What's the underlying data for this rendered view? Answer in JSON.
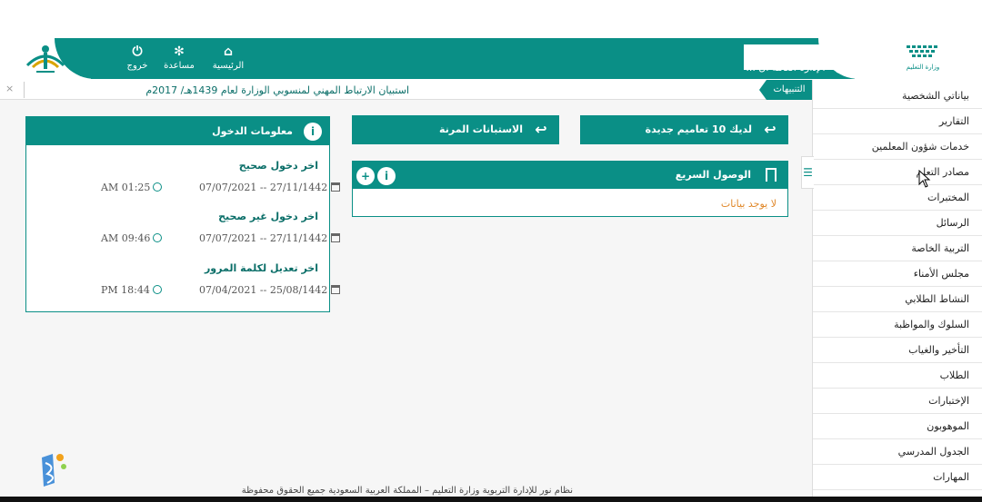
{
  "header": {
    "nav": [
      {
        "label": "الرئيسية",
        "icon": "home-icon"
      },
      {
        "label": "مساعدة",
        "icon": "gear-icon"
      },
      {
        "label": "خروج",
        "icon": "power-icon"
      }
    ],
    "user_text": "ين - الإدارة العامة ال ...",
    "logo_right_text": "وزارة التعليم"
  },
  "alerts": {
    "tab_label": "التنبيهات",
    "text": "استبيان الارتباط المهني لمنسوبي الوزارة لعام 1439هـ/ 2017م",
    "close": "×"
  },
  "sidebar": {
    "toggle": "☰",
    "items": [
      "بياناتي الشخصية",
      "التقارير",
      "خدمات شؤون المعلمين",
      "مصادر التعلم",
      "المختبرات",
      "الرسائل",
      "التربية الخاصة",
      "مجلس الأمناء",
      "النشاط الطلابي",
      "السلوك والمواظبة",
      "التأخير والغياب",
      "الطلاب",
      "الإختبارات",
      "الموهوبون",
      "الجدول المدرسي",
      "المهارات"
    ]
  },
  "buttons": {
    "circulars": "لديك 10 تعاميم جديدة",
    "surveys": "الاستبانات المرنة"
  },
  "quick_access": {
    "title": "الوصول السريع",
    "empty": "لا يوجد بيانات"
  },
  "login_info": {
    "title": "معلومات الدخول",
    "rows": [
      {
        "label": "اخر دخول صحيح",
        "date": "07/07/2021 -- 27/11/1442",
        "time": "AM 01:25"
      },
      {
        "label": "اخر دخول غير صحيح",
        "date": "07/07/2021 -- 27/11/1442",
        "time": "AM 09:46"
      },
      {
        "label": "اخر تعديل لكلمة المرور",
        "date": "07/04/2021 -- 25/08/1442",
        "time": "PM 18:44"
      }
    ]
  },
  "footer": {
    "text": "نظام نور للإدارة التربوية وزارة التعليم – المملكة العربية السعودية جميع الحقوق محفوظة"
  },
  "colors": {
    "primary": "#0a8f86",
    "accent_orange": "#e0882a"
  }
}
